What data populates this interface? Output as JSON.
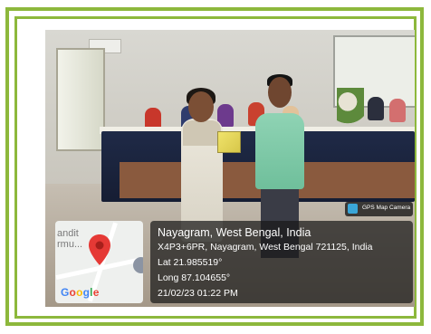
{
  "badge": {
    "label": "GPS Map Camera",
    "icon": "camera-icon"
  },
  "map": {
    "label_line1": "andit",
    "label_line2": "rmu...",
    "provider": "Google",
    "marker_icon": "map-pin-icon",
    "marker_color": "#e53935"
  },
  "location": {
    "title": "Nayagram, West Bengal, India",
    "address": "X4P3+6PR, Nayagram, West Bengal 721125, India",
    "lat": "Lat 21.985519°",
    "long": "Long 87.104655°",
    "datetime": "21/02/23 01:22 PM"
  },
  "colors": {
    "frame": "#8db83c",
    "overlay": "#191919"
  }
}
